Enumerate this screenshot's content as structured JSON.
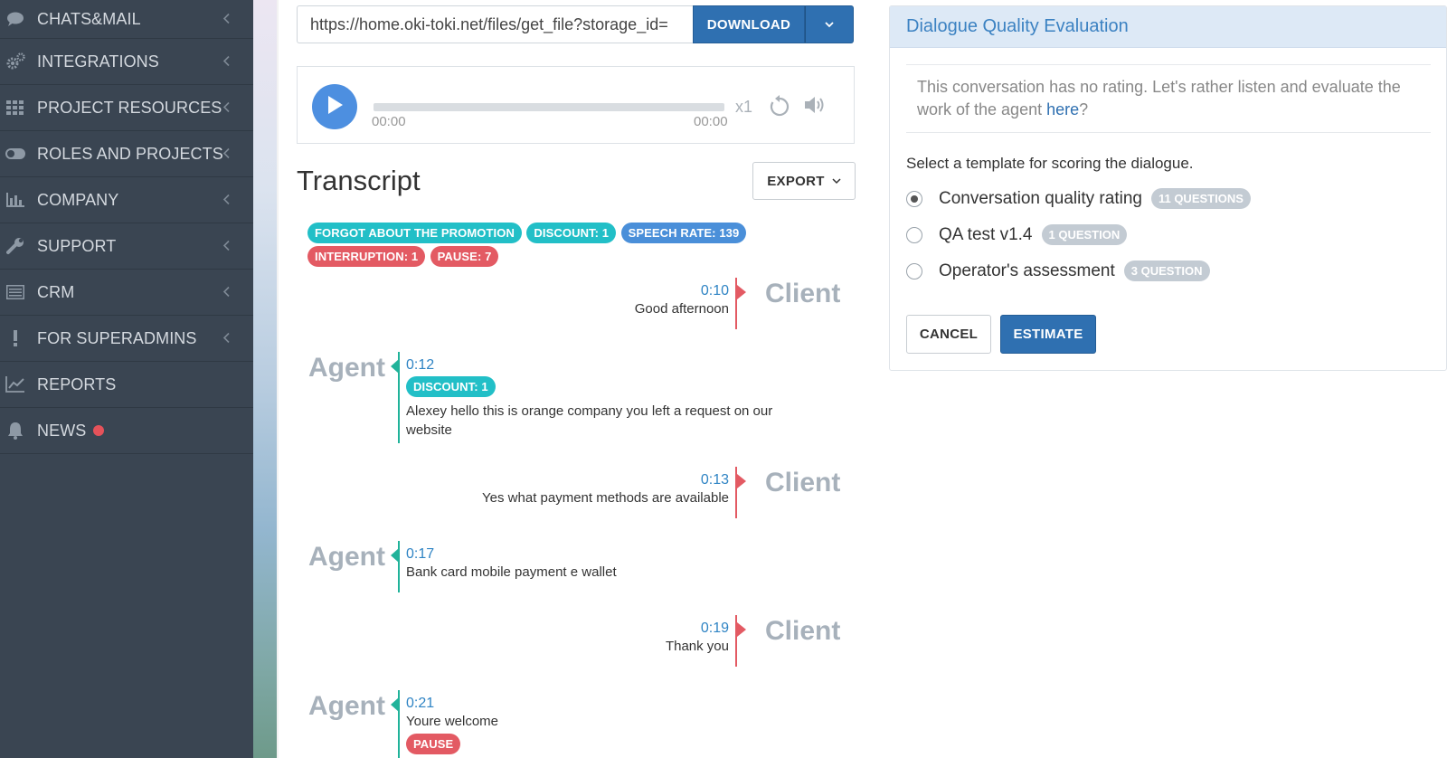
{
  "sidebar": {
    "items": [
      {
        "label": "CHATS&MAIL",
        "icon": "chat-bubble-icon",
        "chevron": true
      },
      {
        "label": "INTEGRATIONS",
        "icon": "gears-icon",
        "chevron": true
      },
      {
        "label": "PROJECT RESOURCES",
        "icon": "grid-icon",
        "chevron": true
      },
      {
        "label": "ROLES AND PROJECTS",
        "icon": "toggle-icon",
        "chevron": true
      },
      {
        "label": "COMPANY",
        "icon": "bar-chart-icon",
        "chevron": true
      },
      {
        "label": "SUPPORT",
        "icon": "wrench-icon",
        "chevron": true
      },
      {
        "label": "CRM",
        "icon": "list-icon",
        "chevron": true
      },
      {
        "label": "FOR SUPERADMINS",
        "icon": "exclamation-icon",
        "chevron": true
      },
      {
        "label": "REPORTS",
        "icon": "line-chart-icon",
        "chevron": false
      },
      {
        "label": "NEWS",
        "icon": "bell-icon",
        "chevron": false,
        "dot_color": "#e5525a"
      }
    ]
  },
  "download": {
    "url": "https://home.oki-toki.net/files/get_file?storage_id=",
    "button_label": "DOWNLOAD"
  },
  "player": {
    "time_start": "00:00",
    "time_end": "00:00",
    "speed": "x1",
    "progress": 0
  },
  "transcript": {
    "title": "Transcript",
    "export_label": "EXPORT",
    "tags_row1": [
      {
        "text": "FORGOT ABOUT THE PROMOTION",
        "color": "teal"
      },
      {
        "text": "DISCOUNT: 1",
        "color": "teal"
      },
      {
        "text": "SPEECH RATE: 139",
        "color": "blue"
      }
    ],
    "tags_row2": [
      {
        "text": "INTERRUPTION: 1",
        "color": "red"
      },
      {
        "text": "PAUSE: 7",
        "color": "red"
      }
    ],
    "speaker_client": "Client",
    "speaker_agent": "Agent",
    "messages": [
      {
        "speaker": "client",
        "time": "0:10",
        "text": "Good afternoon"
      },
      {
        "speaker": "agent",
        "time": "0:12",
        "tag": "DISCOUNT: 1",
        "text": "Alexey hello this is orange company you left a request on our website"
      },
      {
        "speaker": "client",
        "time": "0:13",
        "text": "Yes what payment methods are available"
      },
      {
        "speaker": "agent",
        "time": "0:17",
        "text": "Bank card mobile payment e wallet"
      },
      {
        "speaker": "client",
        "time": "0:19",
        "text": "Thank you"
      },
      {
        "speaker": "agent",
        "time": "0:21",
        "text": "Youre welcome",
        "tag": "PAUSE"
      }
    ]
  },
  "evaluation": {
    "title": "Dialogue Quality Evaluation",
    "note_prefix": "This conversation has no rating. Let's rather listen and evaluate the work of the agent ",
    "note_link": "here",
    "note_suffix": "?",
    "select_label": "Select a template for scoring the dialogue.",
    "templates": [
      {
        "label": "Conversation quality rating",
        "badge": "11 QUESTIONS",
        "selected": true
      },
      {
        "label": "QA test v1.4",
        "badge": "1 QUESTION",
        "selected": false
      },
      {
        "label": "Operator's assessment",
        "badge": "3 QUESTION",
        "selected": false
      }
    ],
    "cancel_label": "CANCEL",
    "estimate_label": "ESTIMATE"
  },
  "colors": {
    "sidebar_bg": "#3a4552",
    "primary": "#2f70b1",
    "teal_tag": "#22bfc7",
    "blue_tag": "#4a8fd9",
    "red_tag": "#e35a63",
    "agent_accent": "#20b39a",
    "client_accent": "#e35a63"
  }
}
